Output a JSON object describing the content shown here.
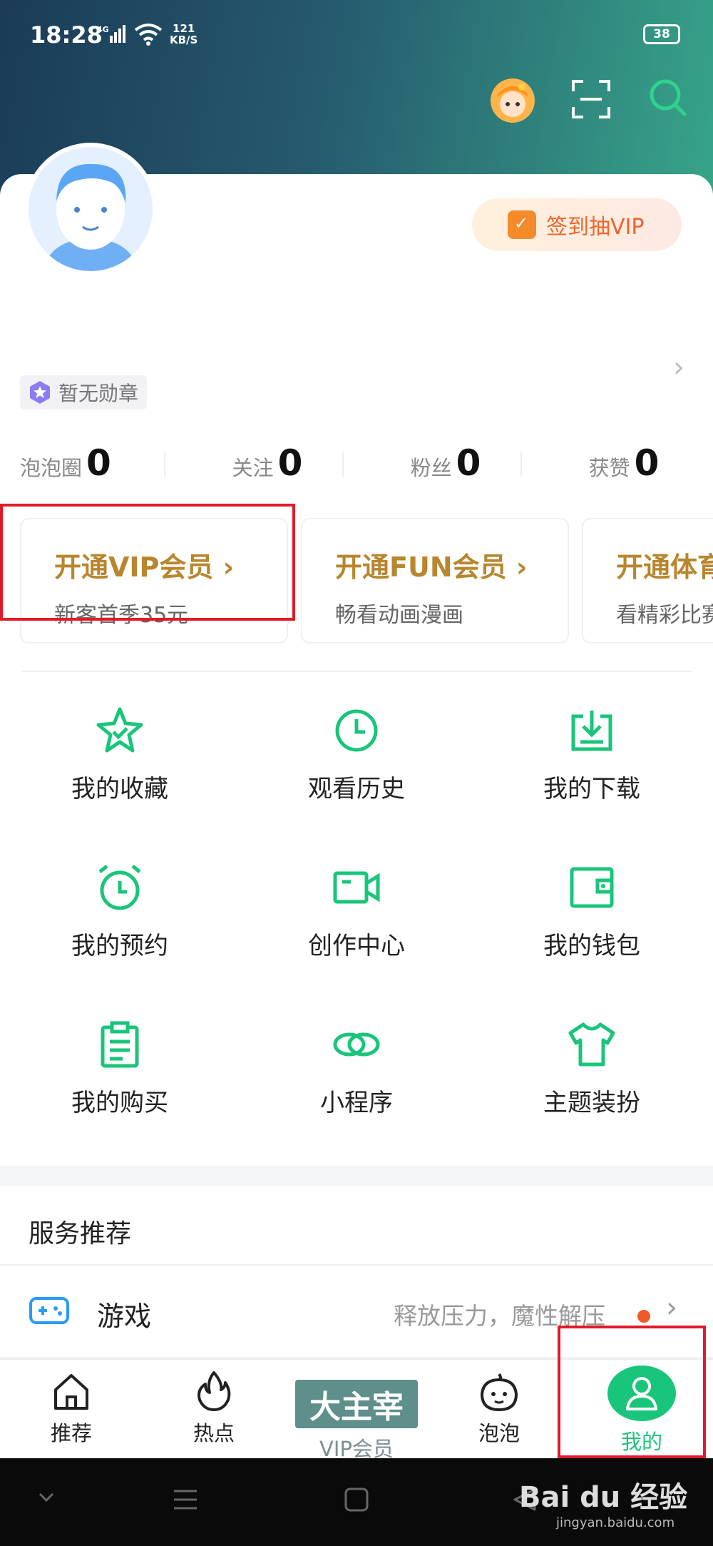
{
  "status": {
    "time": "18:28",
    "network": "4G",
    "speed_value": "121",
    "speed_unit": "KB/S",
    "battery": "38"
  },
  "profile": {
    "signin_label": "签到抽VIP",
    "medal_label": "暂无勋章"
  },
  "stats": [
    {
      "label": "泡泡圈",
      "value": "0"
    },
    {
      "label": "关注",
      "value": "0"
    },
    {
      "label": "粉丝",
      "value": "0"
    },
    {
      "label": "获赞",
      "value": "0"
    }
  ],
  "membership": [
    {
      "title": "开通VIP会员 ›",
      "subtitle": "新客首季35元"
    },
    {
      "title": "开通FUN会员 ›",
      "subtitle": "畅看动画漫画"
    },
    {
      "title": "开通体育",
      "subtitle": "看精彩比赛"
    }
  ],
  "grid": [
    {
      "label": "我的收藏",
      "icon": "star-icon"
    },
    {
      "label": "观看历史",
      "icon": "clock-icon"
    },
    {
      "label": "我的下载",
      "icon": "download-icon"
    },
    {
      "label": "我的预约",
      "icon": "alarm-clock-icon"
    },
    {
      "label": "创作中心",
      "icon": "video-camera-icon"
    },
    {
      "label": "我的钱包",
      "icon": "wallet-icon"
    },
    {
      "label": "我的购买",
      "icon": "clipboard-icon"
    },
    {
      "label": "小程序",
      "icon": "link-icon"
    },
    {
      "label": "主题装扮",
      "icon": "tshirt-icon"
    }
  ],
  "services": {
    "title": "服务推荐",
    "game_name": "游戏",
    "game_desc": "释放压力，魔性解压"
  },
  "nav": [
    {
      "label": "推荐",
      "icon": "home-icon"
    },
    {
      "label": "热点",
      "icon": "flame-icon"
    },
    {
      "label": "VIP会员",
      "badge": "大主宰"
    },
    {
      "label": "泡泡",
      "icon": "bubble-face-icon"
    },
    {
      "label": "我的",
      "icon": "person-icon",
      "active": true
    }
  ],
  "watermark": {
    "brand": "Bai du 经验",
    "url": "jingyan.baidu.com"
  },
  "colors": {
    "accent_green": "#19c57a",
    "gold": "#b8862e",
    "highlight_red": "#e21a28",
    "signin_orange": "#f1642a"
  }
}
